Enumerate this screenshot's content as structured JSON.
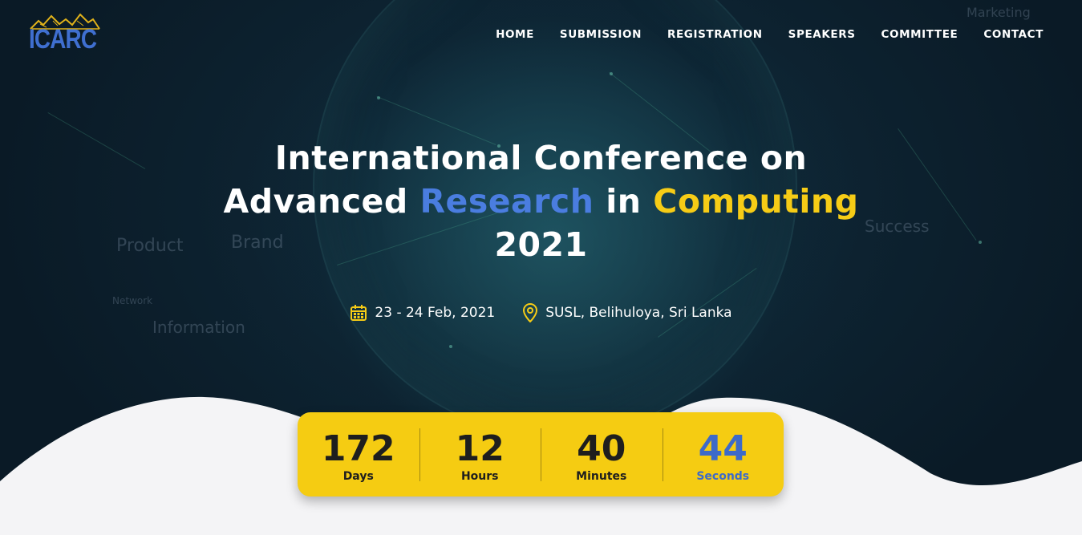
{
  "brand": {
    "logo_text": "ICARC"
  },
  "nav": {
    "items": [
      "HOME",
      "SUBMISSION",
      "REGISTRATION",
      "SPEAKERS",
      "COMMITTEE",
      "CONTACT"
    ]
  },
  "background_words": [
    "Product",
    "Brand",
    "Network",
    "Information",
    "Success",
    "Marketing"
  ],
  "hero": {
    "title_line1": "International Conference on",
    "title_line2_part1": "Advanced",
    "title_line2_part2": "Research",
    "title_line2_part3": "in",
    "title_line2_part4": "Computing",
    "title_line3": "2021",
    "date": "23 - 24 Feb, 2021",
    "date_icon": "calendar-icon",
    "location": "SUSL, Belihuloya, Sri Lanka",
    "location_icon": "map-pin-icon"
  },
  "countdown": {
    "days": {
      "value": "172",
      "label": "Days"
    },
    "hours": {
      "value": "12",
      "label": "Hours"
    },
    "minutes": {
      "value": "40",
      "label": "Minutes"
    },
    "seconds": {
      "value": "44",
      "label": "Seconds"
    }
  },
  "colors": {
    "accent_blue": "#4a7de0",
    "accent_yellow": "#f6cc16",
    "countdown_bg": "#f5cc12",
    "background": "#0b1c28"
  }
}
